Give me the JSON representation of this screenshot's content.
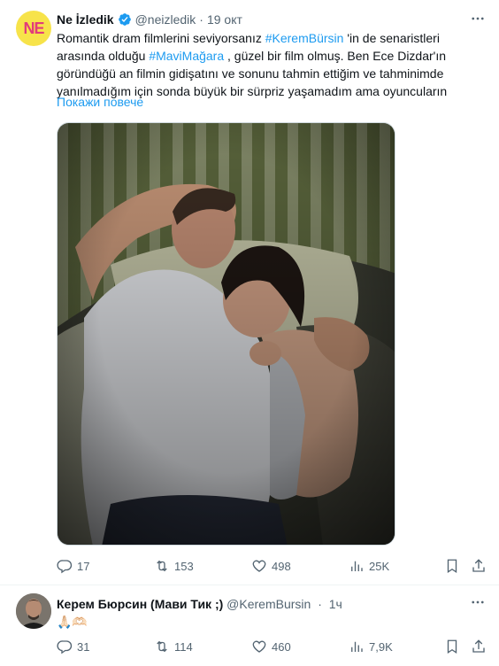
{
  "tweet1": {
    "display_name": "Ne İzledik",
    "handle": "@neizledik",
    "separator": "·",
    "time": "19 окт",
    "avatar_text": "NE",
    "text_parts": {
      "p1": "Romantik dram filmlerini seviyorsanız ",
      "h1": "#KeremBürsin",
      "p2": " 'in de senaristleri arasında olduğu ",
      "h2": "#MaviMağara",
      "p3": " , güzel bir film olmuş. Ben Ece Dizdar'ın göründüğü an filmin gidişatını ve sonunu tahmin ettiğim ve tahminimde yanılmadığım için sonda büyük bir sürpriz yaşamadım ama oyuncuların"
    },
    "show_more": "Покажи повече",
    "stats": {
      "replies": "17",
      "retweets": "153",
      "likes": "498",
      "views": "25K"
    }
  },
  "tweet2": {
    "display_name": "Керем Бюрсин (Мави Тик ;)",
    "handle": "@KeremBursin",
    "separator": "·",
    "time": "1ч",
    "text": "🙏🏻🫶🏻",
    "stats": {
      "replies": "31",
      "retweets": "114",
      "likes": "460",
      "views": "7,9K"
    }
  },
  "colors": {
    "accent": "#1d9bf0",
    "muted": "#536471",
    "text": "#0f1419"
  },
  "icons": [
    "verified-icon",
    "more-icon",
    "reply-icon",
    "retweet-icon",
    "like-icon",
    "views-icon",
    "bookmark-icon",
    "share-icon"
  ]
}
